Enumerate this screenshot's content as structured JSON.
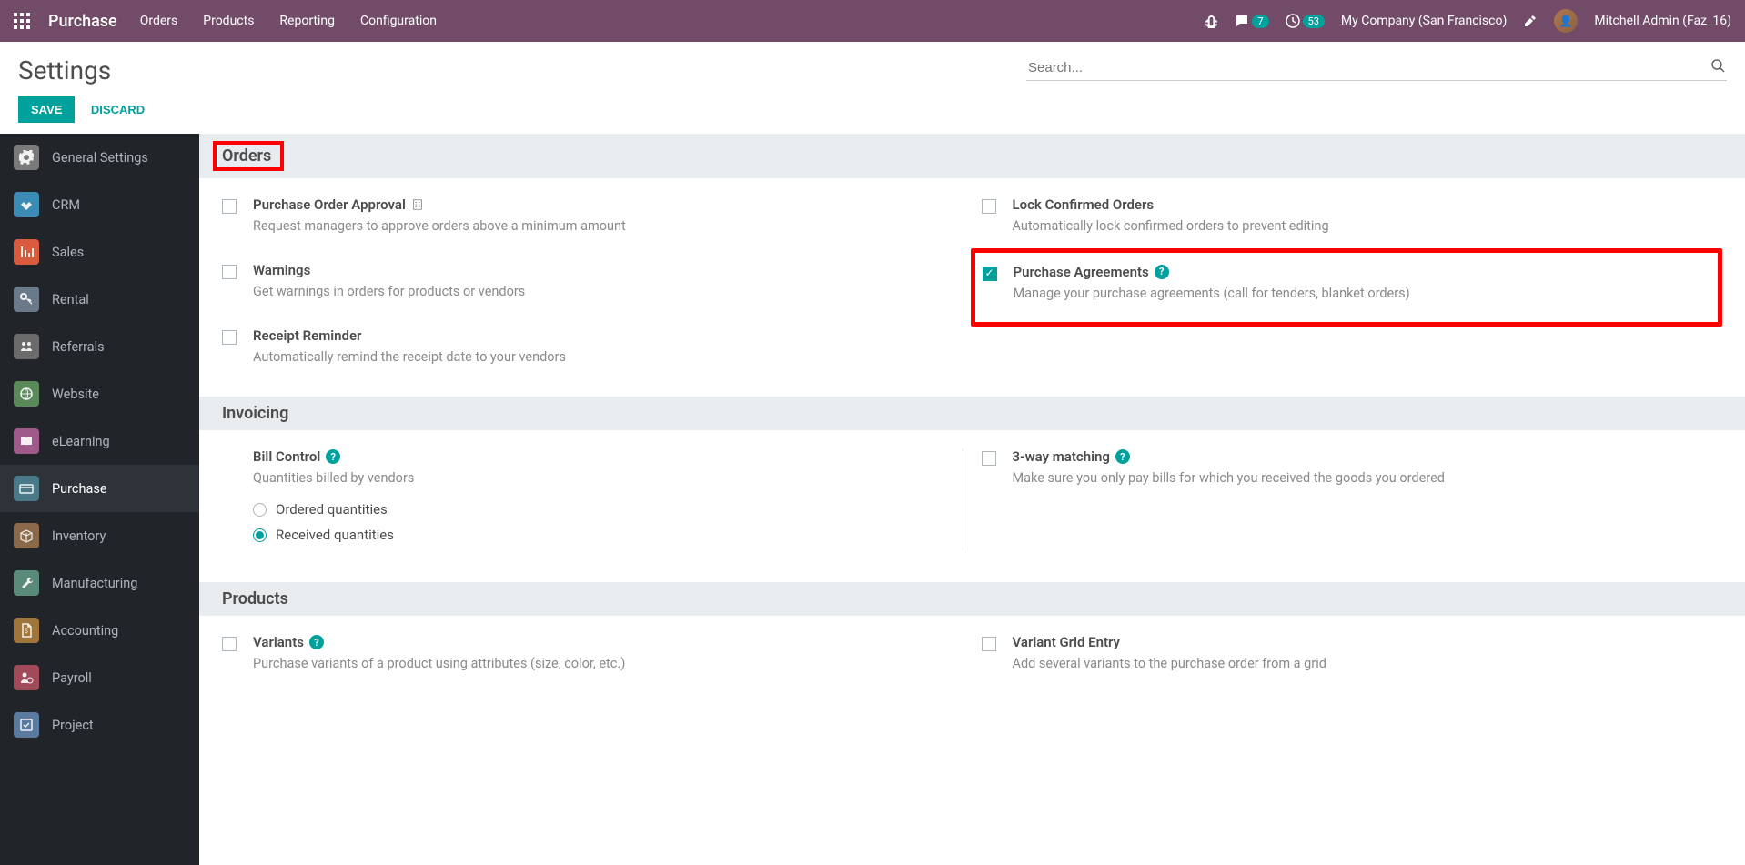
{
  "topnav": {
    "brand": "Purchase",
    "links": [
      "Orders",
      "Products",
      "Reporting",
      "Configuration"
    ],
    "msg_count": "7",
    "activity_count": "53",
    "company": "My Company (San Francisco)",
    "user": "Mitchell Admin (Faz_16)"
  },
  "control": {
    "title": "Settings",
    "save": "SAVE",
    "discard": "DISCARD",
    "search_placeholder": "Search..."
  },
  "sidebar": [
    {
      "label": "General Settings",
      "icon": "general"
    },
    {
      "label": "CRM",
      "icon": "crm"
    },
    {
      "label": "Sales",
      "icon": "sales"
    },
    {
      "label": "Rental",
      "icon": "rental"
    },
    {
      "label": "Referrals",
      "icon": "referrals"
    },
    {
      "label": "Website",
      "icon": "website"
    },
    {
      "label": "eLearning",
      "icon": "elearning"
    },
    {
      "label": "Purchase",
      "icon": "purchase",
      "active": true
    },
    {
      "label": "Inventory",
      "icon": "inventory"
    },
    {
      "label": "Manufacturing",
      "icon": "manufacturing"
    },
    {
      "label": "Accounting",
      "icon": "accounting"
    },
    {
      "label": "Payroll",
      "icon": "payroll"
    },
    {
      "label": "Project",
      "icon": "project"
    }
  ],
  "sections": {
    "orders": {
      "header": "Orders",
      "items": {
        "approval": {
          "title": "Purchase Order Approval",
          "desc": "Request managers to approve orders above a minimum amount",
          "checked": false
        },
        "lock": {
          "title": "Lock Confirmed Orders",
          "desc": "Automatically lock confirmed orders to prevent editing",
          "checked": false
        },
        "warnings": {
          "title": "Warnings",
          "desc": "Get warnings in orders for products or vendors",
          "checked": false
        },
        "agreements": {
          "title": "Purchase Agreements",
          "desc": "Manage your purchase agreements (call for tenders, blanket orders)",
          "checked": true
        },
        "reminder": {
          "title": "Receipt Reminder",
          "desc": "Automatically remind the receipt date to your vendors",
          "checked": false
        }
      }
    },
    "invoicing": {
      "header": "Invoicing",
      "bill_control": {
        "title": "Bill Control",
        "desc": "Quantities billed by vendors",
        "opt1": "Ordered quantities",
        "opt2": "Received quantities"
      },
      "matching": {
        "title": "3-way matching",
        "desc": "Make sure you only pay bills for which you received the goods you ordered",
        "checked": false
      }
    },
    "products": {
      "header": "Products",
      "variants": {
        "title": "Variants",
        "desc": "Purchase variants of a product using attributes (size, color, etc.)",
        "checked": false
      },
      "grid": {
        "title": "Variant Grid Entry",
        "desc": "Add several variants to the purchase order from a grid",
        "checked": false
      }
    }
  }
}
